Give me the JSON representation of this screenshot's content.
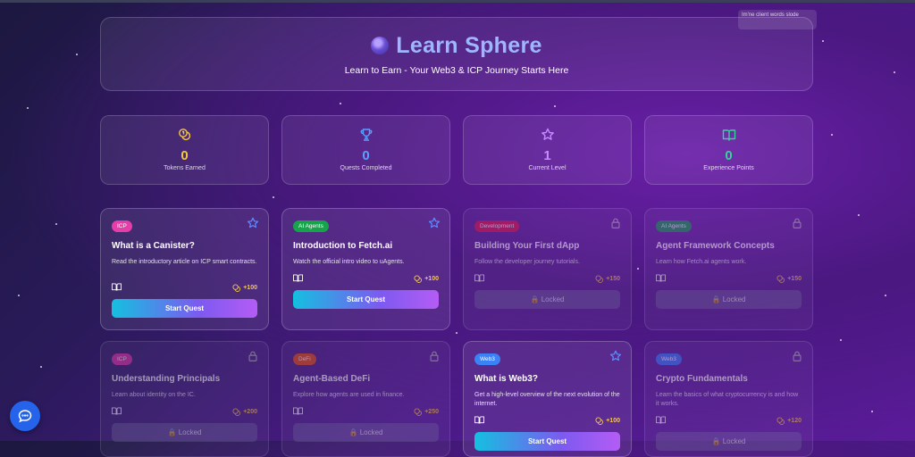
{
  "tooltip": "Im'ne client words slode",
  "hero": {
    "title": "Learn Sphere",
    "subtitle": "Learn to Earn - Your Web3 & ICP Journey Starts Here"
  },
  "stats": [
    {
      "value": "0",
      "label": "Tokens Earned",
      "icon": "coins-icon",
      "color": "#f6c744"
    },
    {
      "value": "0",
      "label": "Quests Completed",
      "icon": "trophy-icon",
      "color": "#5aa0ff"
    },
    {
      "value": "1",
      "label": "Current Level",
      "icon": "star-icon",
      "color": "#c58bff"
    },
    {
      "value": "0",
      "label": "Experience Points",
      "icon": "book-open-icon",
      "color": "#34d399"
    }
  ],
  "quests": [
    {
      "tag": "ICP",
      "tag_color": "#e63ea8",
      "title": "What is a Canister?",
      "desc": "Read the introductory article on ICP smart contracts.",
      "reward": "+100",
      "status": "available",
      "action": "Start Quest"
    },
    {
      "tag": "AI Agents",
      "tag_color": "#16a34a",
      "title": "Introduction to Fetch.ai",
      "desc": "Watch the official intro video to uAgents.",
      "reward": "+100",
      "status": "available",
      "action": "Start Quest"
    },
    {
      "tag": "Development",
      "tag_color": "#e11d48",
      "title": "Building Your First dApp",
      "desc": "Follow the developer journey tutorials.",
      "reward": "+150",
      "status": "locked",
      "action": "Locked"
    },
    {
      "tag": "AI Agents",
      "tag_color": "#16a34a",
      "title": "Agent Framework Concepts",
      "desc": "Learn how Fetch.ai agents work.",
      "reward": "+150",
      "status": "locked",
      "action": "Locked"
    },
    {
      "tag": "ICP",
      "tag_color": "#e63ea8",
      "title": "Understanding Principals",
      "desc": "Learn about identity on the IC.",
      "reward": "+200",
      "status": "locked",
      "action": "Locked"
    },
    {
      "tag": "DeFi",
      "tag_color": "#ea580c",
      "title": "Agent-Based DeFi",
      "desc": "Explore how agents are used in finance.",
      "reward": "+250",
      "status": "locked",
      "action": "Locked"
    },
    {
      "tag": "Web3",
      "tag_color": "#3b82f6",
      "title": "What is Web3?",
      "desc": "Get a high-level overview of the next evolution of the internet.",
      "reward": "+100",
      "status": "available",
      "action": "Start Quest"
    },
    {
      "tag": "Web3",
      "tag_color": "#3b82f6",
      "title": "Crypto Fundamentals",
      "desc": "Learn the basics of what cryptocurrency is and how it works.",
      "reward": "+120",
      "status": "locked",
      "action": "Locked"
    }
  ],
  "chat_button": {
    "icon": "chat-bubble-icon"
  }
}
